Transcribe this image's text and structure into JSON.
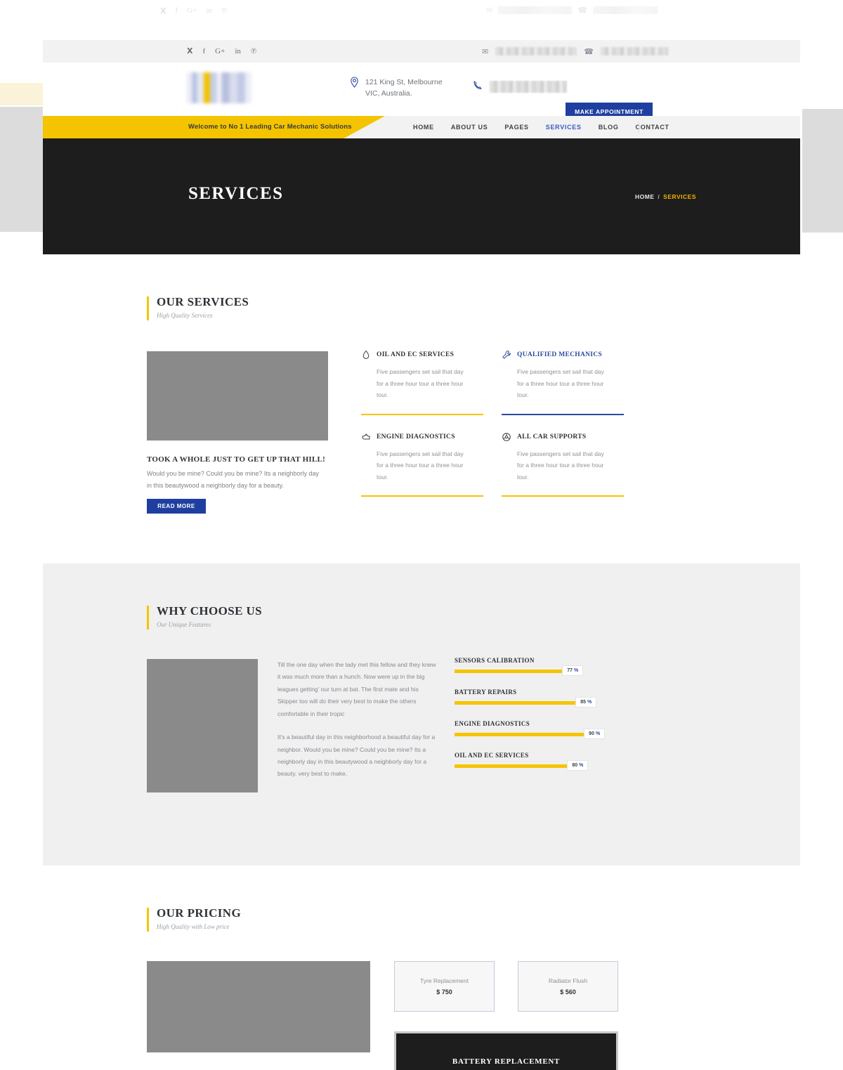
{
  "topbar": {
    "social": [
      {
        "name": "twitter-icon",
        "glyph": "𝐭"
      },
      {
        "name": "facebook-icon",
        "glyph": "f"
      },
      {
        "name": "google-plus-icon",
        "glyph": "G+"
      },
      {
        "name": "linkedin-icon",
        "glyph": "in"
      },
      {
        "name": "pinterest-icon",
        "glyph": "℗"
      }
    ],
    "email_icon": "✉",
    "phone_icon": "☎",
    "email_value": "",
    "phone_value": ""
  },
  "header": {
    "address": "121 King St, Melbourne VIC, Australia.",
    "location_icon": "⌘",
    "phone_icon": "☎",
    "phone_value": "",
    "appointment_label": "MAKE APPOINTMENT"
  },
  "nav": {
    "welcome_text": "Welcome to No 1 Leading Car Mechanic Solutions",
    "items": [
      {
        "label": "HOME",
        "active": false
      },
      {
        "label": "ABOUT US",
        "active": false
      },
      {
        "label": "PAGES",
        "active": false
      },
      {
        "label": "SERVICES",
        "active": true
      },
      {
        "label": "BLOG",
        "active": false
      },
      {
        "label": "CONTACT",
        "active": false
      }
    ],
    "search_icon": "⌕"
  },
  "hero": {
    "title": "SERVICES",
    "breadcrumb_home": "HOME",
    "breadcrumb_sep": "/",
    "breadcrumb_current": "SERVICES"
  },
  "services": {
    "title": "OUR SERVICES",
    "subtitle": "High Quality Services",
    "left_heading": "TOOK A WHOLE JUST TO GET UP THAT HILL!",
    "left_body": "Would you be mine? Could you be mine? Its a neighborly day in this beautywood a neighborly day for a beauty.",
    "read_more_label": "READ MORE",
    "cards": [
      {
        "title": "OIL AND EC SERVICES",
        "body": "Five passengers set sail that day for a three hour tour a three hour tour.",
        "icon": "oil-drop-icon",
        "accent": "#f5c400",
        "title_color": "#2e3237"
      },
      {
        "title": "QUALIFIED MECHANICS",
        "body": "Five passengers set sail that day for a three hour tour a three hour tour.",
        "icon": "wrench-icon",
        "accent": "#2b4b9b",
        "title_color": "#2b4b9b"
      },
      {
        "title": "ENGINE DIAGNOSTICS",
        "body": "Five passengers set sail that day for a three hour tour a three hour tour.",
        "icon": "engine-icon",
        "accent": "#f5c400",
        "title_color": "#2e3237"
      },
      {
        "title": "ALL CAR SUPPORTS",
        "body": "Five passengers set sail that day for a three hour tour a three hour tour.",
        "icon": "steering-wheel-icon",
        "accent": "#f5c400",
        "title_color": "#2e3237"
      }
    ]
  },
  "why": {
    "title": "WHY CHOOSE US",
    "subtitle": "Our Unique Features",
    "paragraph1": "Till the one day when the lady met this fellow and they knew it was much more than a hunch. Now were up in the big leagues getting' our turn at bat. The first mate and his Skipper too will do their very best to make the others comfortable in their tropic",
    "paragraph2": "It's a beautiful day in this neighborhood a beautiful day for a neighbor. Would you be mine? Could you be mine? Its a neighborly day in this beautywood a neighborly day for a beauty. very best to make.",
    "skills": [
      {
        "label": "SENSORS CALIBRATION",
        "value": 77,
        "display": "77",
        "unit": "%"
      },
      {
        "label": "BATTERY REPAIRS",
        "value": 85,
        "display": "85",
        "unit": "%"
      },
      {
        "label": "ENGINE DIAGNOSTICS",
        "value": 90,
        "display": "90",
        "unit": "%"
      },
      {
        "label": "OIL AND EC SERVICES",
        "value": 80,
        "display": "80",
        "unit": "%"
      }
    ]
  },
  "pricing": {
    "title": "OUR PRICING",
    "subtitle": "High Quality with Low price",
    "cards": [
      {
        "name": "Tyre Replacement",
        "price": "$ 750"
      },
      {
        "name": "Radiator Flush",
        "price": "$ 560"
      }
    ],
    "featured": "BATTERY REPLACEMENT"
  },
  "colors": {
    "accent_yellow": "#f5c400",
    "accent_blue": "#1f3fa0",
    "dark": "#1d1d1d",
    "light_gray": "#f0f0f0"
  }
}
